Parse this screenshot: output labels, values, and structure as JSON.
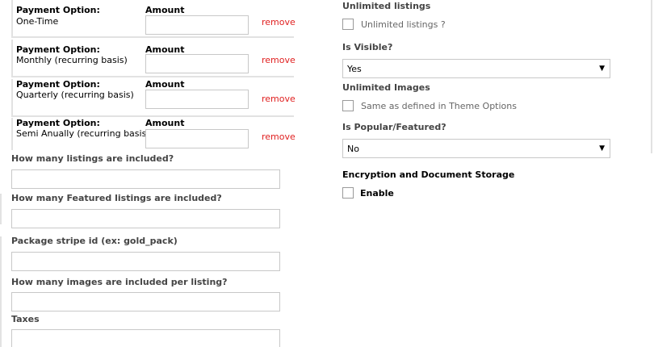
{
  "payment_options": [
    {
      "label": "Payment Option:",
      "value": "One-Time",
      "amount_label": "Amount",
      "amount_value": "",
      "remove": "remove"
    },
    {
      "label": "Payment Option:",
      "value": "Monthly (recurring basis)",
      "amount_label": "Amount",
      "amount_value": "",
      "remove": "remove"
    },
    {
      "label": "Payment Option:",
      "value": "Quarterly (recurring basis)",
      "amount_label": "Amount",
      "amount_value": "",
      "remove": "remove"
    },
    {
      "label": "Payment Option:",
      "value": "Semi Anually (recurring basis)",
      "amount_label": "Amount",
      "amount_value": "",
      "remove": "remove"
    }
  ],
  "fields": {
    "listings_included": {
      "label": "How many listings are included?",
      "value": ""
    },
    "featured_listings": {
      "label": "How many Featured listings are included?",
      "value": ""
    },
    "stripe_id": {
      "label": "Package stripe id (ex: gold_pack)",
      "value": ""
    },
    "images_per_listing": {
      "label": "How many images are included per listing?",
      "value": ""
    },
    "taxes": {
      "label": "Taxes",
      "value": ""
    }
  },
  "right": {
    "unlimited_listings": {
      "heading": "Unlimited listings",
      "checkbox_label": "Unlimited listings ?",
      "checked": false
    },
    "is_visible": {
      "label": "Is Visible?",
      "selected": "Yes"
    },
    "unlimited_images": {
      "heading": "Unlimited Images",
      "checkbox_label": "Same as defined in Theme Options",
      "checked": false
    },
    "popular": {
      "label": "Is Popular/Featured?",
      "selected": "No"
    },
    "encryption": {
      "heading": "Encryption and Document Storage",
      "checkbox_label": "Enable",
      "checked": false
    }
  },
  "icons": {
    "select_arrow": "caret-down-icon"
  }
}
